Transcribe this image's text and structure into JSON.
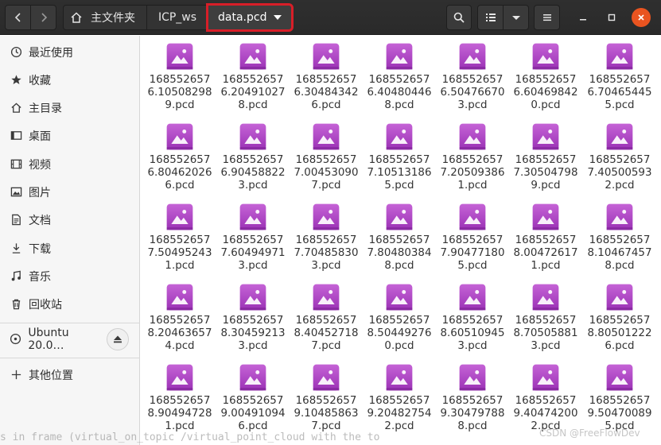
{
  "colors": {
    "header_bg": "#2c2c2c",
    "accent_close": "#e95420",
    "highlight_border": "#d81e28",
    "icon_gradient_top": "#c563d6",
    "icon_gradient_bottom": "#9b32b5",
    "sidebar_bg": "#f6f6f6"
  },
  "header": {
    "nav_back_icon": "chevron-left-icon",
    "nav_forward_icon": "chevron-right-icon",
    "breadcrumbs": [
      {
        "icon": "home-icon",
        "label": "主文件夹"
      },
      {
        "label": "ICP_ws"
      },
      {
        "label": "data.pcd",
        "has_dropdown": true
      }
    ],
    "search_icon": "search-icon",
    "view_icon": "list-view-icon",
    "view_menu_icon": "chevron-down-icon",
    "menu_icon": "hamburger-menu-icon",
    "window_controls": [
      "minimize-icon",
      "maximize-icon",
      "close-icon"
    ]
  },
  "sidebar": {
    "items": [
      {
        "icon": "recent-icon",
        "label": "最近使用"
      },
      {
        "icon": "star-icon",
        "label": "收藏"
      },
      {
        "icon": "home-icon",
        "label": "主目录"
      },
      {
        "icon": "desktop-icon",
        "label": "桌面"
      },
      {
        "icon": "video-icon",
        "label": "视频"
      },
      {
        "icon": "picture-icon",
        "label": "图片"
      },
      {
        "icon": "document-icon",
        "label": "文档"
      },
      {
        "icon": "download-icon",
        "label": "下载"
      },
      {
        "icon": "music-icon",
        "label": "音乐"
      },
      {
        "icon": "trash-icon",
        "label": "回收站"
      }
    ],
    "devices": [
      {
        "icon": "disk-icon",
        "label": "Ubuntu 20.0…",
        "eject_icon": "eject-icon"
      }
    ],
    "other": {
      "icon": "plus-icon",
      "label": "其他位置"
    }
  },
  "files": [
    {
      "line1": "168552657",
      "line2": "6.10508298",
      "line3": "9.pcd"
    },
    {
      "line1": "168552657",
      "line2": "6.20491027",
      "line3": "8.pcd"
    },
    {
      "line1": "168552657",
      "line2": "6.30484342",
      "line3": "6.pcd"
    },
    {
      "line1": "168552657",
      "line2": "6.40480446",
      "line3": "8.pcd"
    },
    {
      "line1": "168552657",
      "line2": "6.50476670",
      "line3": "3.pcd"
    },
    {
      "line1": "168552657",
      "line2": "6.60469842",
      "line3": "0.pcd"
    },
    {
      "line1": "168552657",
      "line2": "6.70465445",
      "line3": "5.pcd"
    },
    {
      "line1": "168552657",
      "line2": "6.80462026",
      "line3": "6.pcd"
    },
    {
      "line1": "168552657",
      "line2": "6.90458822",
      "line3": "3.pcd"
    },
    {
      "line1": "168552657",
      "line2": "7.00453090",
      "line3": "7.pcd"
    },
    {
      "line1": "168552657",
      "line2": "7.10513186",
      "line3": "5.pcd"
    },
    {
      "line1": "168552657",
      "line2": "7.20509386",
      "line3": "1.pcd"
    },
    {
      "line1": "168552657",
      "line2": "7.30504798",
      "line3": "9.pcd"
    },
    {
      "line1": "168552657",
      "line2": "7.40500593",
      "line3": "2.pcd"
    },
    {
      "line1": "168552657",
      "line2": "7.50495243",
      "line3": "1.pcd"
    },
    {
      "line1": "168552657",
      "line2": "7.60494971",
      "line3": "3.pcd"
    },
    {
      "line1": "168552657",
      "line2": "7.70485830",
      "line3": "3.pcd"
    },
    {
      "line1": "168552657",
      "line2": "7.80480384",
      "line3": "8.pcd"
    },
    {
      "line1": "168552657",
      "line2": "7.90477180",
      "line3": "5.pcd"
    },
    {
      "line1": "168552657",
      "line2": "8.00472617",
      "line3": "1.pcd"
    },
    {
      "line1": "168552657",
      "line2": "8.10467457",
      "line3": "8.pcd"
    },
    {
      "line1": "168552657",
      "line2": "8.20463657",
      "line3": "4.pcd"
    },
    {
      "line1": "168552657",
      "line2": "8.30459213",
      "line3": "3.pcd"
    },
    {
      "line1": "168552657",
      "line2": "8.40452718",
      "line3": "7.pcd"
    },
    {
      "line1": "168552657",
      "line2": "8.50449276",
      "line3": "0.pcd"
    },
    {
      "line1": "168552657",
      "line2": "8.60510945",
      "line3": "3.pcd"
    },
    {
      "line1": "168552657",
      "line2": "8.70505881",
      "line3": "3.pcd"
    },
    {
      "line1": "168552657",
      "line2": "8.80501222",
      "line3": "6.pcd"
    },
    {
      "line1": "168552657",
      "line2": "8.90494728",
      "line3": "1.pcd"
    },
    {
      "line1": "168552657",
      "line2": "9.00491094",
      "line3": "6.pcd"
    },
    {
      "line1": "168552657",
      "line2": "9.10485863",
      "line3": "7.pcd"
    },
    {
      "line1": "168552657",
      "line2": "9.20482754",
      "line3": "2.pcd"
    },
    {
      "line1": "168552657",
      "line2": "9.30479788",
      "line3": "8.pcd"
    },
    {
      "line1": "168552657",
      "line2": "9.40474200",
      "line3": "2.pcd"
    },
    {
      "line1": "168552657",
      "line2": "9.50470089",
      "line3": "5.pcd"
    }
  ],
  "file_icon": "image-file-icon",
  "bottom_overlay_text": "s in frame (virtual_on_topic /virtual_point_cloud with the to",
  "watermark": "CSDN @FreeFlowDev"
}
